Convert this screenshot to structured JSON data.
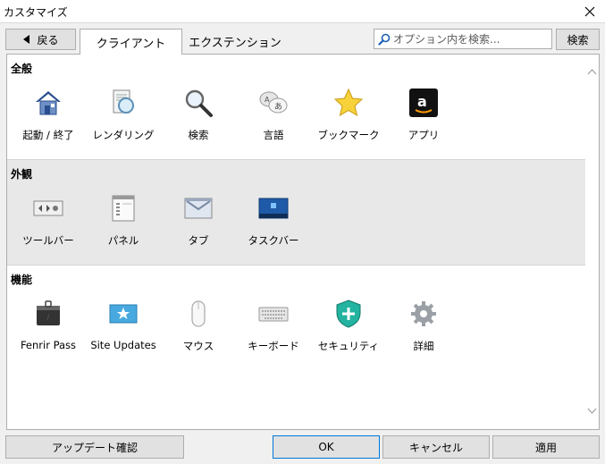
{
  "window": {
    "title": "カスタマイズ"
  },
  "nav": {
    "back_label": "戻る"
  },
  "tabs": [
    {
      "label": "クライアント",
      "active": true
    },
    {
      "label": "エクステンション",
      "active": false
    }
  ],
  "search": {
    "placeholder": "オプション内を検索...",
    "button_label": "検索"
  },
  "sections": [
    {
      "title": "全般",
      "items": [
        {
          "label": "起動 / 終了",
          "icon": "house-icon"
        },
        {
          "label": "レンダリング",
          "icon": "render-document-icon"
        },
        {
          "label": "検索",
          "icon": "magnifier-icon"
        },
        {
          "label": "言語",
          "icon": "language-icon"
        },
        {
          "label": "ブックマーク",
          "icon": "star-icon"
        },
        {
          "label": "アプリ",
          "icon": "amazon-app-icon"
        }
      ]
    },
    {
      "title": "外観",
      "items": [
        {
          "label": "ツールバー",
          "icon": "toolbar-icon"
        },
        {
          "label": "パネル",
          "icon": "panel-icon"
        },
        {
          "label": "タブ",
          "icon": "tab-icon"
        },
        {
          "label": "タスクバー",
          "icon": "taskbar-icon"
        }
      ]
    },
    {
      "title": "機能",
      "items": [
        {
          "label": "Fenrir Pass",
          "icon": "fenrir-pass-icon"
        },
        {
          "label": "Site Updates",
          "icon": "site-updates-icon"
        },
        {
          "label": "マウス",
          "icon": "mouse-icon"
        },
        {
          "label": "キーボード",
          "icon": "keyboard-icon"
        },
        {
          "label": "セキュリティ",
          "icon": "security-shield-icon"
        },
        {
          "label": "詳細",
          "icon": "gear-icon"
        }
      ]
    }
  ],
  "footer": {
    "update_label": "アップデート確認",
    "ok_label": "OK",
    "cancel_label": "キャンセル",
    "apply_label": "適用"
  },
  "colors": {
    "accent": "#0078d7",
    "shaded_section": "#e8e8e8",
    "window_bg": "#f0f0f0"
  }
}
